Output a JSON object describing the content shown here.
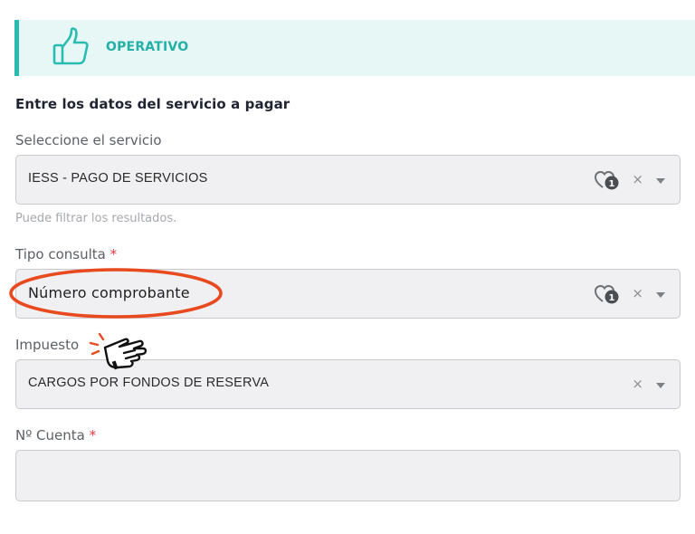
{
  "banner": {
    "icon": "thumbs-up-icon",
    "title": "OPERATIVO",
    "accent": "#2bbcb1"
  },
  "form": {
    "section_title": "Entre los datos del servicio a pagar",
    "servicio": {
      "label": "Seleccione el servicio",
      "value": "IESS - PAGO DE SERVICIOS",
      "hint": "Puede filtrar los resultados.",
      "clear": "×"
    },
    "tipo_consulta": {
      "label": "Tipo consulta",
      "required": "*",
      "value": "Número comprobante",
      "clear": "×"
    },
    "impuesto": {
      "label": "Impuesto",
      "value": "CARGOS POR FONDOS DE RESERVA",
      "clear": "×"
    },
    "cuenta": {
      "label": "Nº Cuenta",
      "required": "*",
      "value": ""
    }
  },
  "annotation": {
    "circle_color": "#e8491f",
    "pointer_icon": "hand-pointer-icon"
  }
}
